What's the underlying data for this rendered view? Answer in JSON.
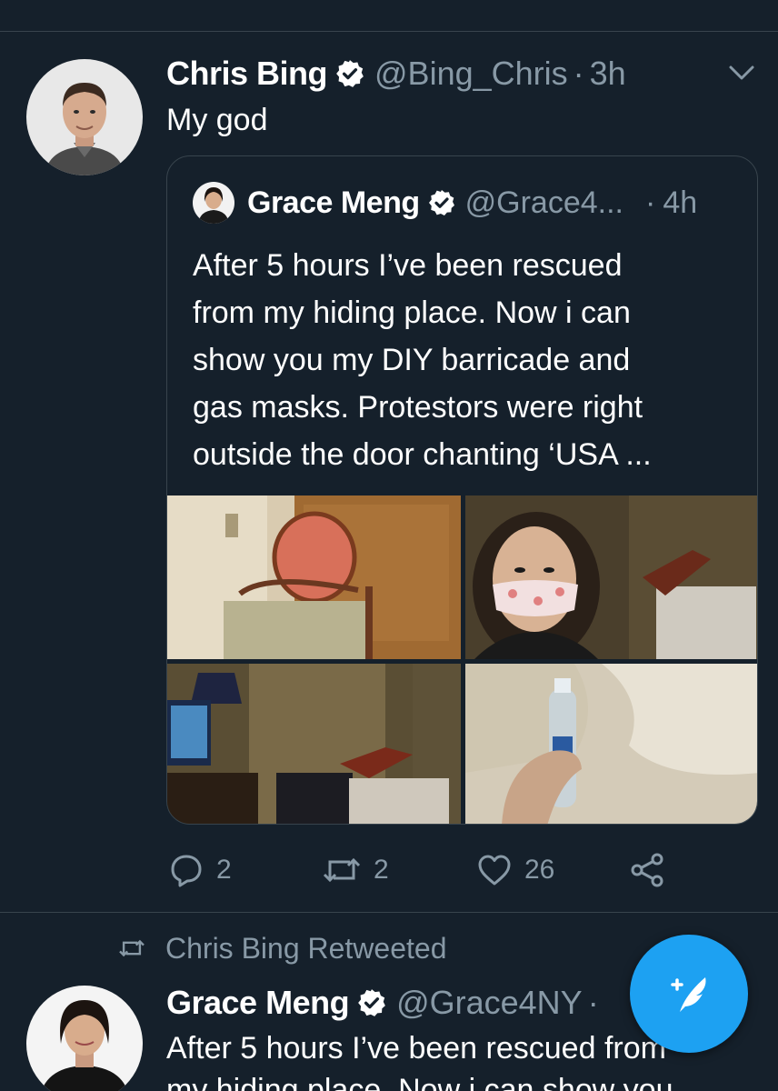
{
  "tweet": {
    "author_name": "Chris Bing",
    "handle": "@Bing_Chris",
    "separator": "·",
    "time": "3h",
    "text": "My god",
    "avatar_icon": "user-avatar-photo",
    "verified_icon": "verified-badge-icon"
  },
  "quoted": {
    "author_name": "Grace Meng",
    "handle": "@Grace4...",
    "separator": "·",
    "time": "4h",
    "lines": [
      "After 5 hours I’ve been rescued",
      "from my hiding place. Now i can",
      "show you my DIY barricade and",
      "gas masks. Protestors were right",
      "outside the door chanting ‘USA ..."
    ]
  },
  "actions": {
    "reply_count": "2",
    "retweet_count": "2",
    "like_count": "26"
  },
  "retweet_banner": {
    "label": "Chris Bing Retweeted"
  },
  "tweet2": {
    "author_name": "Grace Meng",
    "handle": "@Grace4NY",
    "separator": "·",
    "text": "After 5 hours I’ve been rescued from",
    "text_line2": "my hiding place. Now i can show you"
  },
  "colors": {
    "background": "#15202b",
    "secondary_text": "#8899a6",
    "accent": "#1da1f2",
    "border": "#38444d"
  }
}
